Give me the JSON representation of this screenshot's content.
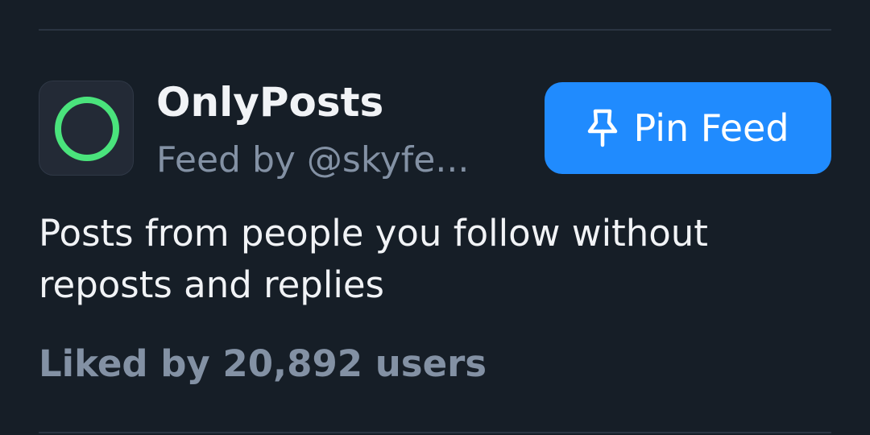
{
  "feed": {
    "title": "OnlyPosts",
    "creator": "Feed by @skyfe...",
    "description": "Posts from people you follow without reposts and replies",
    "likes": "Liked by 20,892 users",
    "avatar_icon": "green-ring-icon",
    "avatar_color": "#4ae37c"
  },
  "pin_button": {
    "label": "Pin Feed",
    "icon": "pin-icon",
    "color": "#208bfe"
  },
  "theme": {
    "background": "#161e27",
    "text_primary": "#f1f3f6",
    "text_secondary": "#8391a4"
  }
}
